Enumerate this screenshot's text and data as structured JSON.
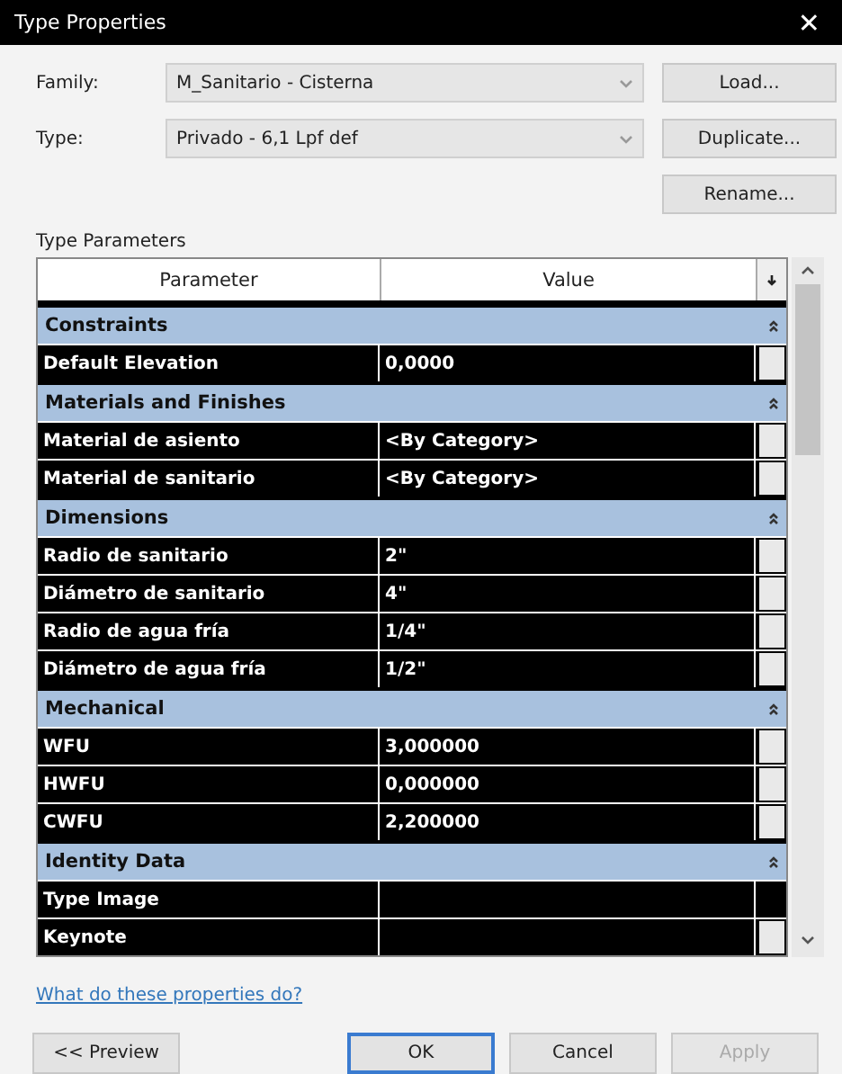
{
  "window": {
    "title": "Type Properties",
    "close": "✕"
  },
  "fields": [
    {
      "label": "Family:",
      "value": "M_Sanitario - Cisterna"
    },
    {
      "label": "Type:",
      "value": "Privado - 6,1 Lpf def"
    }
  ],
  "side_buttons": [
    "Load...",
    "Duplicate...",
    "Rename..."
  ],
  "section_label": "Type Parameters",
  "table": {
    "columns": [
      "Parameter",
      "Value"
    ],
    "groups": [
      {
        "name": "Constraints",
        "expanded": true,
        "rows": [
          {
            "parameter": "Default Elevation",
            "value": "0,0000",
            "button": true
          }
        ]
      },
      {
        "name": "Materials and Finishes",
        "expanded": true,
        "rows": [
          {
            "parameter": "Material de asiento",
            "value": "<By Category>",
            "button": true
          },
          {
            "parameter": "Material de sanitario",
            "value": "<By Category>",
            "button": true
          }
        ]
      },
      {
        "name": "Dimensions",
        "expanded": true,
        "rows": [
          {
            "parameter": "Radio de sanitario",
            "value": "2\"",
            "button": true
          },
          {
            "parameter": "Diámetro de sanitario",
            "value": "4\"",
            "button": true
          },
          {
            "parameter": "Radio de agua fría",
            "value": "1/4\"",
            "button": true
          },
          {
            "parameter": "Diámetro de agua fría",
            "value": "1/2\"",
            "button": true
          }
        ]
      },
      {
        "name": "Mechanical",
        "expanded": true,
        "rows": [
          {
            "parameter": "WFU",
            "value": "3,000000",
            "button": true
          },
          {
            "parameter": "HWFU",
            "value": "0,000000",
            "button": true
          },
          {
            "parameter": "CWFU",
            "value": "2,200000",
            "button": true
          }
        ]
      },
      {
        "name": "Identity Data",
        "expanded": true,
        "rows": [
          {
            "parameter": "Type Image",
            "value": "",
            "button": false
          },
          {
            "parameter": "Keynote",
            "value": "",
            "button": true
          }
        ]
      }
    ]
  },
  "help_link": "What do these properties do?",
  "buttons": [
    {
      "label": "<< Preview",
      "default": false,
      "disabled": false
    },
    {
      "label": "OK",
      "default": true,
      "disabled": false
    },
    {
      "label": "Cancel",
      "default": false,
      "disabled": false
    },
    {
      "label": "Apply",
      "default": false,
      "disabled": true
    }
  ]
}
